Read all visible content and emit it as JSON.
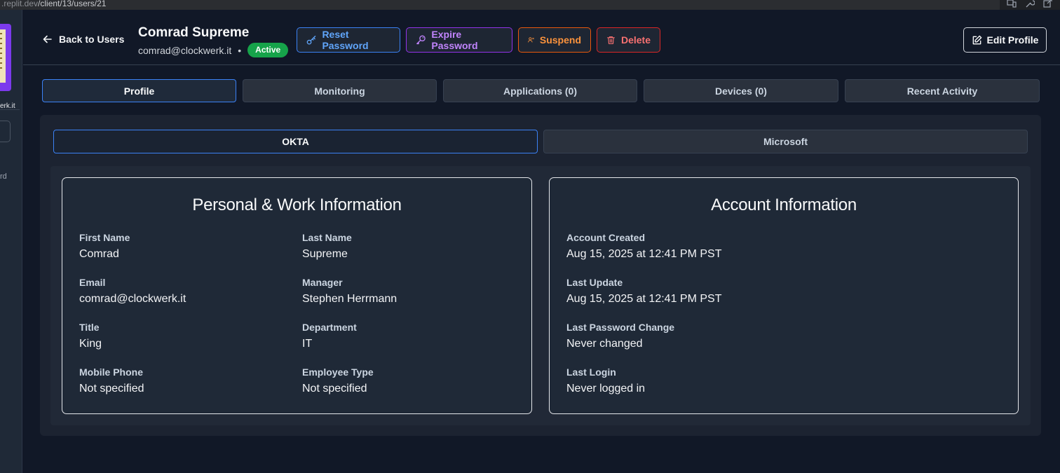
{
  "browser": {
    "url_prefix": ".replit.dev",
    "url_path": "/client/13/users/21"
  },
  "sidebar": {
    "org_fragment": "erk.it",
    "text_fragment": "rd"
  },
  "header": {
    "back_label": "Back to Users",
    "user_name": "Comrad Supreme",
    "user_email": "comrad@clockwerk.it",
    "separator": "•",
    "status": "Active",
    "actions": {
      "reset_password": "Reset Password",
      "expire_password": "Expire Password",
      "suspend": "Suspend",
      "delete": "Delete"
    },
    "edit_profile": "Edit Profile"
  },
  "tabs": [
    {
      "label": "Profile",
      "active": true
    },
    {
      "label": "Monitoring",
      "active": false
    },
    {
      "label": "Applications (0)",
      "active": false
    },
    {
      "label": "Devices (0)",
      "active": false
    },
    {
      "label": "Recent Activity",
      "active": false
    }
  ],
  "subtabs": [
    {
      "label": "OKTA",
      "active": true
    },
    {
      "label": "Microsoft",
      "active": false
    }
  ],
  "personal": {
    "title": "Personal & Work Information",
    "fields": [
      {
        "label": "First Name",
        "value": "Comrad"
      },
      {
        "label": "Last Name",
        "value": "Supreme"
      },
      {
        "label": "Email",
        "value": "comrad@clockwerk.it"
      },
      {
        "label": "Manager",
        "value": "Stephen Herrmann"
      },
      {
        "label": "Title",
        "value": "King"
      },
      {
        "label": "Department",
        "value": "IT"
      },
      {
        "label": "Mobile Phone",
        "value": "Not specified"
      },
      {
        "label": "Employee Type",
        "value": "Not specified"
      }
    ]
  },
  "account": {
    "title": "Account Information",
    "fields": [
      {
        "label": "Account Created",
        "value": "Aug 15, 2025 at 12:41 PM PST"
      },
      {
        "label": "Last Update",
        "value": "Aug 15, 2025 at 12:41 PM PST"
      },
      {
        "label": "Last Password Change",
        "value": "Never changed"
      },
      {
        "label": "Last Login",
        "value": "Never logged in"
      }
    ]
  },
  "colors": {
    "background": "#111827",
    "accent_blue": "#3b82f6",
    "status_green": "#16a34a",
    "purple": "#9333ea",
    "orange": "#ea580c",
    "red": "#dc2626"
  }
}
